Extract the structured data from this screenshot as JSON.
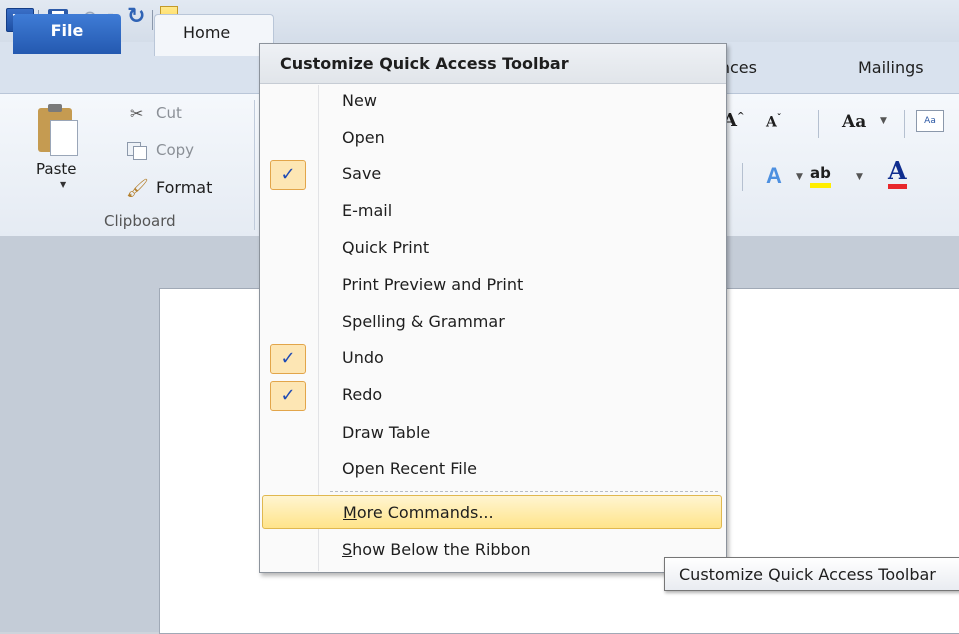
{
  "qat": {
    "word_icon": "word-app-icon",
    "word_letter": "W",
    "save_icon": "save-icon",
    "undo_icon": "undo-icon",
    "redo_icon": "redo-icon",
    "customize_icon": "chevron-down-icon"
  },
  "tabs": {
    "file": "File",
    "home": "Home",
    "references_partial": "ences",
    "mailings": "Mailings"
  },
  "clipboard": {
    "paste": "Paste",
    "cut": "Cut",
    "copy": "Copy",
    "format": "Format",
    "group_label": "Clipboard"
  },
  "font_group": {
    "grow": "A",
    "shrink": "A",
    "change_case": "Aa",
    "clear_format": "Aa",
    "text_effect": "A",
    "highlight": "ab",
    "font_color": "A",
    "highlight_color": "#ffee00",
    "font_color_bar": "#e8282b"
  },
  "menu": {
    "title": "Customize Quick Access Toolbar",
    "items": [
      {
        "label": "New",
        "checked": false
      },
      {
        "label": "Open",
        "checked": false
      },
      {
        "label": "Save",
        "checked": true
      },
      {
        "label": "E-mail",
        "checked": false
      },
      {
        "label": "Quick Print",
        "checked": false
      },
      {
        "label": "Print Preview and Print",
        "checked": false
      },
      {
        "label": "Spelling & Grammar",
        "checked": false
      },
      {
        "label": "Undo",
        "checked": true
      },
      {
        "label": "Redo",
        "checked": true
      },
      {
        "label": "Draw Table",
        "checked": false
      },
      {
        "label": "Open Recent File",
        "checked": false
      }
    ],
    "more_commands": {
      "accel": "M",
      "rest": "ore Commands..."
    },
    "show_below": {
      "accel": "S",
      "rest": "how Below the Ribbon"
    },
    "check_mark": "✓"
  },
  "tooltip": {
    "text": "Customize Quick Access Toolbar"
  },
  "colors": {
    "file_tab": "#2f6ac4",
    "hover_bg": "#ffe48a",
    "check_bg": "#fde6b4"
  }
}
